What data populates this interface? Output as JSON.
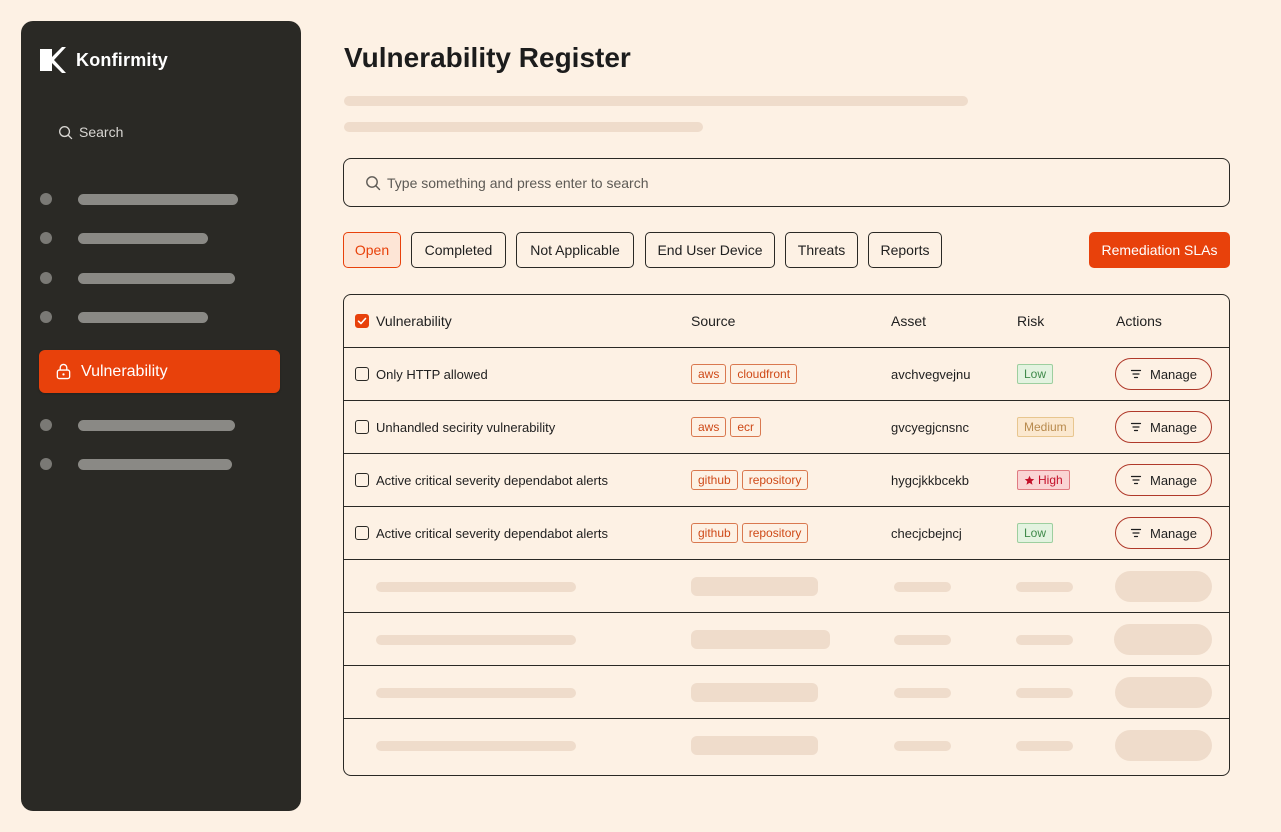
{
  "brand": {
    "name": "Konfirmity"
  },
  "sidebar": {
    "search_label": "Search",
    "active_item": {
      "label": "Vulnerability",
      "icon": "lock-icon"
    }
  },
  "main": {
    "title": "Vulnerability Register",
    "search_placeholder": "Type something and press enter to search",
    "tabs": [
      {
        "label": "Open",
        "active": true
      },
      {
        "label": "Completed"
      },
      {
        "label": "Not Applicable"
      },
      {
        "label": "End User Device"
      },
      {
        "label": "Threats"
      },
      {
        "label": "Reports"
      }
    ],
    "primary_action": "Remediation SLAs"
  },
  "table": {
    "columns": [
      "Vulnerability",
      "Source",
      "Asset",
      "Risk",
      "Actions"
    ],
    "rows": [
      {
        "name": "Only HTTP allowed",
        "sources": [
          "aws",
          "cloudfront"
        ],
        "asset": "avchvegvejnu",
        "risk": "Low",
        "action": "Manage"
      },
      {
        "name": "Unhandled secirity vulnerability",
        "sources": [
          "aws",
          "ecr"
        ],
        "asset": "gvcyegjcnsnc",
        "risk": "Medium",
        "action": "Manage"
      },
      {
        "name": "Active critical severity dependabot alerts",
        "sources": [
          "github",
          "repository"
        ],
        "asset": "hygcjkkbcekb",
        "risk": "High",
        "action": "Manage"
      },
      {
        "name": "Active critical severity dependabot alerts",
        "sources": [
          "github",
          "repository"
        ],
        "asset": "checjcbejncj",
        "risk": "Low",
        "action": "Manage"
      }
    ]
  },
  "colors": {
    "accent": "#e8410b",
    "sidebar_bg": "#2a2925",
    "page_bg": "#fdf1e4"
  }
}
